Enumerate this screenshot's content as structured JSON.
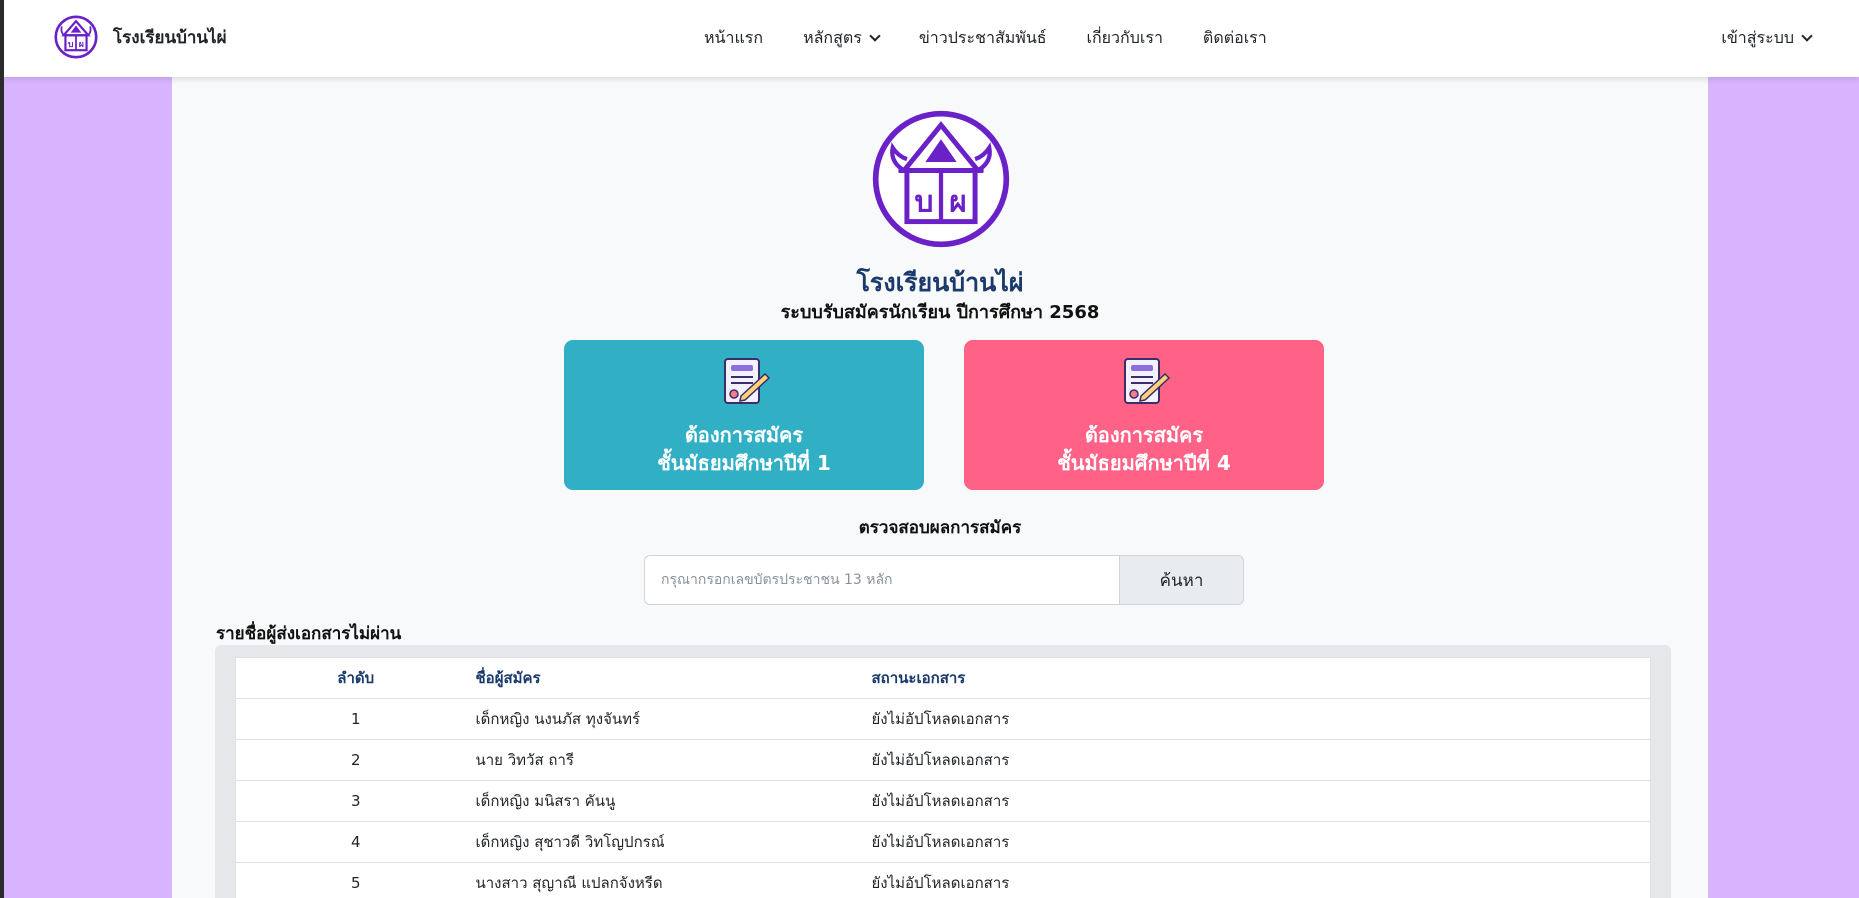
{
  "nav": {
    "brand": "โรงเรียนบ้านไผ่",
    "links": [
      "หน้าแรก",
      "หลักสูตร",
      "ข่าวประชาสัมพันธ์",
      "เกี่ยวกับเรา",
      "ติดต่อเรา"
    ],
    "login": "เข้าสู่ระบบ"
  },
  "hero": {
    "title": "โรงเรียนบ้านไผ่",
    "subtitle": "ระบบรับสมัครนักเรียน ปีการศึกษา 2568",
    "logo_text": "บผ"
  },
  "cards": [
    {
      "line1": "ต้องการสมัคร",
      "line2": "ชั้นมัธยมศึกษาปีที่ 1"
    },
    {
      "line1": "ต้องการสมัคร",
      "line2": "ชั้นมัธยมศึกษาปีที่ 4"
    }
  ],
  "check": {
    "title": "ตรวจสอบผลการสมัคร",
    "placeholder": "กรุณากรอกเลขบัตรประชาชน 13 หลัก",
    "button": "ค้นหา"
  },
  "fail_list": {
    "title": "รายชื่อผู้ส่งเอกสารไม่ผ่าน",
    "headers": [
      "ลำดับ",
      "ชื่อผู้สมัคร",
      "สถานะเอกสาร"
    ],
    "rows": [
      [
        "1",
        "เด็กหญิง นงนภัส ทุงจันทร์",
        "ยังไม่อัปโหลดเอกสาร"
      ],
      [
        "2",
        "นาย วิทวัส ถารี",
        "ยังไม่อัปโหลดเอกสาร"
      ],
      [
        "3",
        "เด็กหญิง มนิสรา คันนู",
        "ยังไม่อัปโหลดเอกสาร"
      ],
      [
        "4",
        "เด็กหญิง สุชาวดี วิทโญปกรณ์",
        "ยังไม่อัปโหลดเอกสาร"
      ],
      [
        "5",
        "นางสาว สุญาณี แปลกจังหรีด",
        "ยังไม่อัปโหลดเอกสาร"
      ]
    ]
  },
  "colors": {
    "side_bg": "#d8b4fe",
    "brand_purple": "#6b21c8",
    "card_m1": "#31b0c5",
    "card_m4": "#ff6286"
  }
}
